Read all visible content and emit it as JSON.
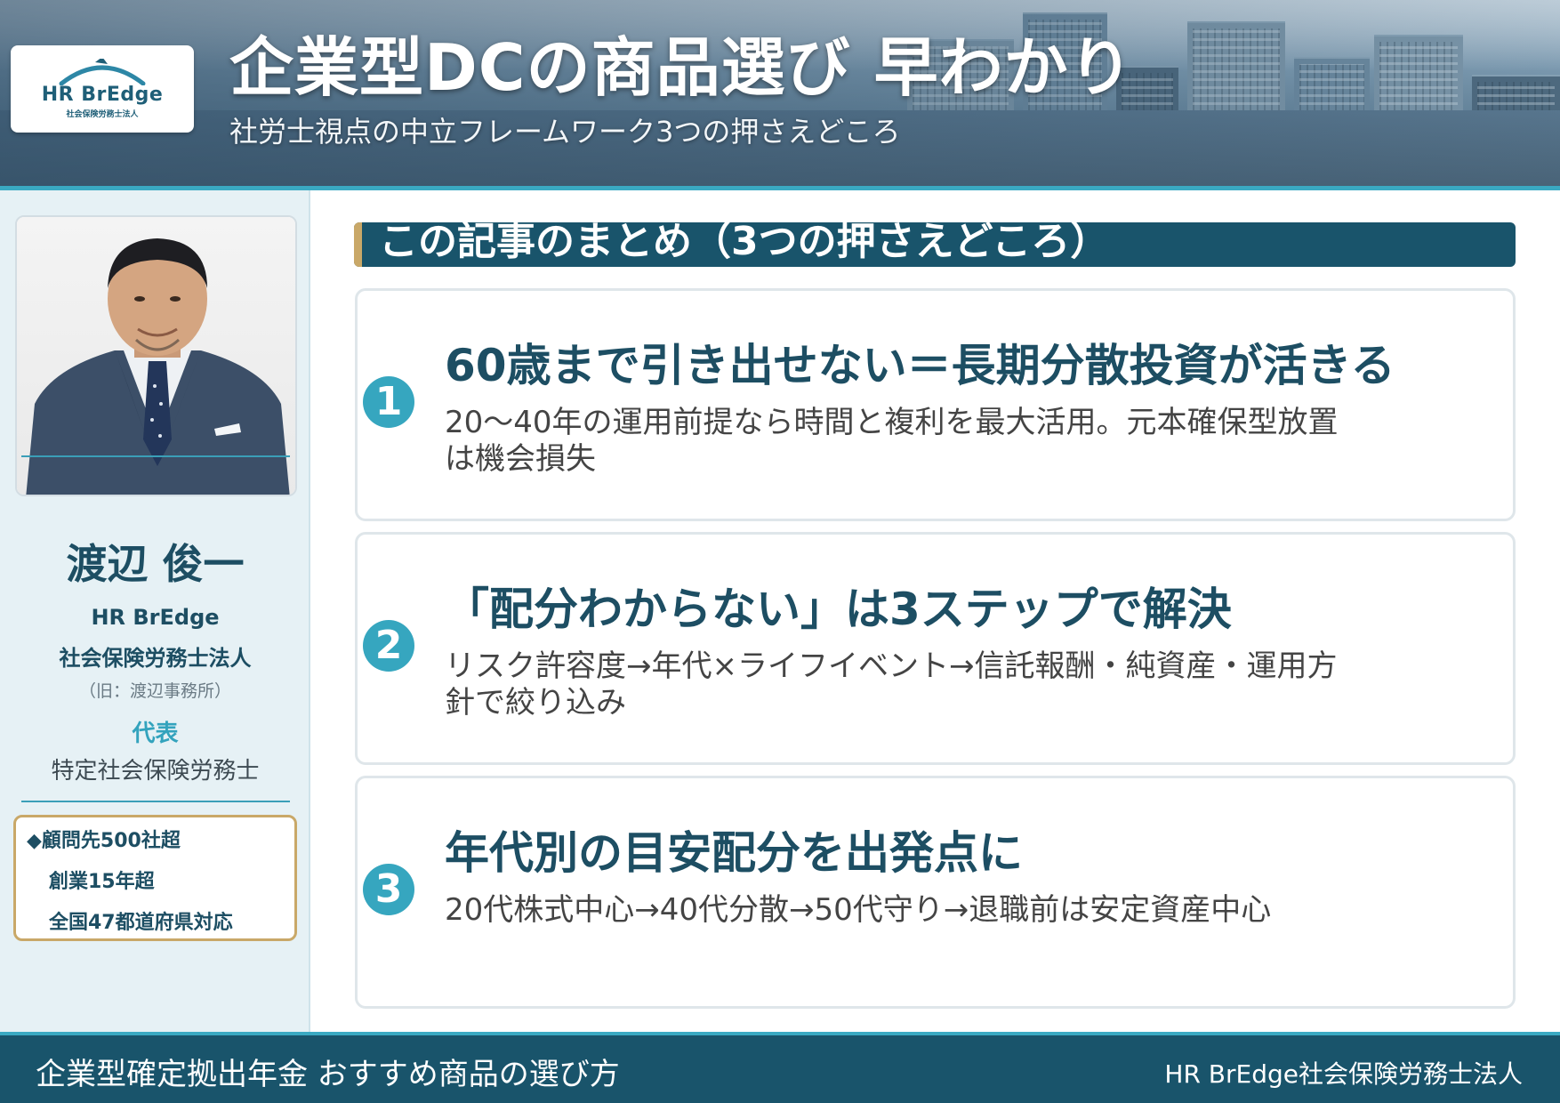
{
  "header": {
    "title": "企業型DCの商品選び 早わかり",
    "subtitle": "社労士視点の中立フレームワーク3つの押さえどころ",
    "logo": {
      "brand": "HR BrEdge",
      "sub": "社会保険労務士法人"
    }
  },
  "profile": {
    "name": "渡辺 俊一",
    "org_line1": "HR BrEdge",
    "org_line2": "社会保険労務士法人",
    "former_name": "（旧：渡辺事務所）",
    "role": "代表",
    "certification": "特定社会保険労務士",
    "highlights": [
      "◆顧問先500社超",
      "創業15年超",
      "全国47都道府県対応"
    ]
  },
  "summary": {
    "heading": "この記事のまとめ（3つの押さえどころ）",
    "cards": [
      {
        "number": "1",
        "title": "60歳まで引き出せない＝長期分散投資が活きる",
        "body": "20～40年の運用前提なら時間と複利を最大活用。元本確保型放置は機会損失"
      },
      {
        "number": "2",
        "title": "「配分わからない」は3ステップで解決",
        "body": "リスク許容度→年代×ライフイベント→信託報酬・純資産・運用方針で絞り込み"
      },
      {
        "number": "3",
        "title": "年代別の目安配分を出発点に",
        "body": "20代株式中心→40代分散→50代守り→退職前は安定資産中心"
      }
    ]
  },
  "footer": {
    "left": "企業型確定拠出年金 おすすめ商品の選び方",
    "right": "HR BrEdge社会保険労務士法人"
  },
  "colors": {
    "navy": "#19546b",
    "teal": "#36a6bf",
    "gold": "#c9a868",
    "sidebar_bg": "#e6f1f5"
  }
}
